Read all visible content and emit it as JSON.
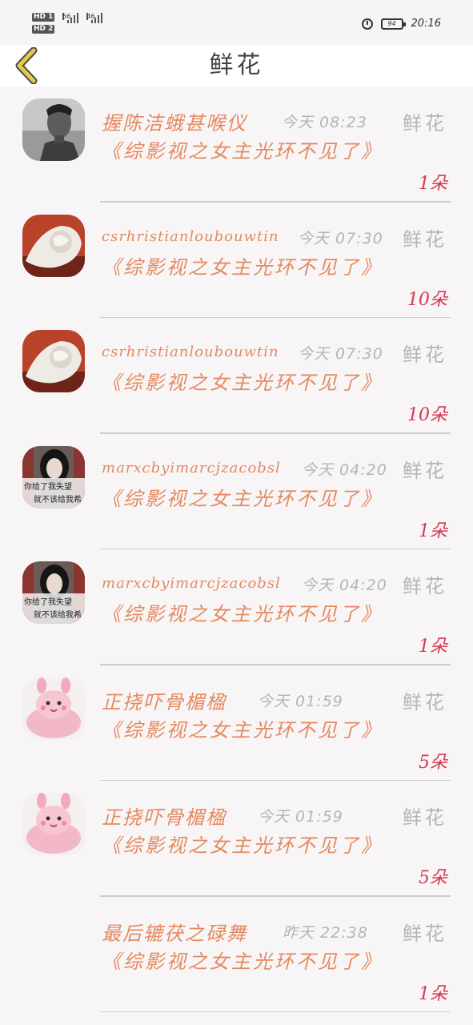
{
  "status_bar": {
    "sim1": "HD 1",
    "sim2": "HD 2",
    "net1": "56",
    "net2": "46",
    "battery": "94",
    "time": "20:16"
  },
  "header": {
    "title": "鲜花",
    "back_icon": "chevron-left-icon",
    "accent": "#e8c84a"
  },
  "items": [
    {
      "name": "握陈洁蛾甚喉仪",
      "time": "今天 08:23",
      "tag": "鲜花",
      "book": "《综影视之女主光环不见了》",
      "count": "1朵",
      "avatar": "male-portrait"
    },
    {
      "name": "csrhristianloubouwtin",
      "time": "今天 07:30",
      "tag": "鲜花",
      "book": "《综影视之女主光环不见了》",
      "count": "10朵",
      "avatar": "white-carving"
    },
    {
      "name": "csrhristianloubouwtin",
      "time": "今天 07:30",
      "tag": "鲜花",
      "book": "《综影视之女主光环不见了》",
      "count": "10朵",
      "avatar": "white-carving"
    },
    {
      "name": "marxcbyimarcjzacobsl",
      "time": "今天 04:20",
      "tag": "鲜花",
      "book": "《综影视之女主光环不见了》",
      "count": "1朵",
      "avatar": "girl-photo"
    },
    {
      "name": "marxcbyimarcjzacobsl",
      "time": "今天 04:20",
      "tag": "鲜花",
      "book": "《综影视之女主光环不见了》",
      "count": "1朵",
      "avatar": "girl-photo"
    },
    {
      "name": "正挠吓骨楣楹",
      "time": "今天 01:59",
      "tag": "鲜花",
      "book": "《综影视之女主光环不见了》",
      "count": "5朵",
      "avatar": "pink-bunny"
    },
    {
      "name": "正挠吓骨楣楹",
      "time": "今天 01:59",
      "tag": "鲜花",
      "book": "《综影视之女主光环不见了》",
      "count": "5朵",
      "avatar": "pink-bunny"
    },
    {
      "name": "最后辘茯之碌舞",
      "time": "昨天 22:38",
      "tag": "鲜花",
      "book": "《综影视之女主光环不见了》",
      "count": "1朵",
      "avatar": "none"
    }
  ],
  "avatar_captions": {
    "girl_line1": "你给了我失望",
    "girl_line2": "就不该给我希"
  },
  "colors": {
    "name": "#e48a60",
    "muted": "#b7b4b5",
    "count": "#d43a54"
  }
}
